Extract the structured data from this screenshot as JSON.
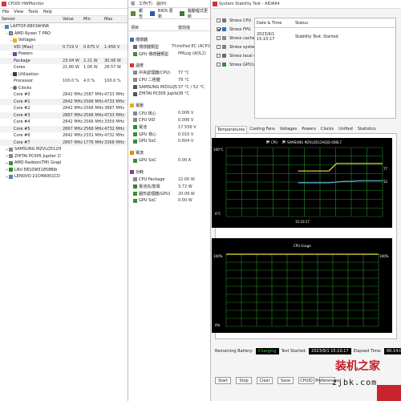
{
  "hwmonitor": {
    "title": "CPUID HWMonitor",
    "menu": [
      "File",
      "View",
      "Tools",
      "Help"
    ],
    "columns": [
      "Sensor",
      "Value",
      "Min",
      "Max"
    ],
    "rows": [
      {
        "label": "LAPTOP-8803AHNR",
        "icon": "computer-icon",
        "indent": 0,
        "toggle": "−",
        "value": "",
        "min": "",
        "max": ""
      },
      {
        "label": "AMD Ryzen 7 PRO",
        "icon": "cpu-icon",
        "indent": 1,
        "toggle": "−",
        "value": "",
        "min": "",
        "max": ""
      },
      {
        "label": "Voltages",
        "icon": "voltage-icon",
        "indent": 2,
        "toggle": "−",
        "value": "",
        "min": "",
        "max": ""
      },
      {
        "label": "VID (Max)",
        "icon": "",
        "indent": 3,
        "toggle": "",
        "value": "0.719 V",
        "min": "0.675 V",
        "max": "1.456 V"
      },
      {
        "label": "Powers",
        "icon": "power-icon",
        "indent": 2,
        "toggle": "−",
        "value": "",
        "min": "",
        "max": ""
      },
      {
        "label": "Package",
        "icon": "",
        "indent": 3,
        "toggle": "",
        "value": "23.04 W",
        "min": "2.21 W",
        "max": "30.06 W"
      },
      {
        "label": "Cores",
        "icon": "",
        "indent": 3,
        "toggle": "",
        "value": "21.80 W",
        "min": "1.06 W",
        "max": "28.57 W"
      },
      {
        "label": "Utilization",
        "icon": "utilization-icon",
        "indent": 2,
        "toggle": "−",
        "value": "",
        "min": "",
        "max": ""
      },
      {
        "label": "Processor",
        "icon": "",
        "indent": 3,
        "toggle": "",
        "value": "100.0 %",
        "min": "4.0 %",
        "max": "100.0 %"
      },
      {
        "label": "Clocks",
        "icon": "clock-icon",
        "indent": 2,
        "toggle": "−",
        "value": "",
        "min": "",
        "max": ""
      },
      {
        "label": "Core #0",
        "icon": "",
        "indent": 3,
        "toggle": "",
        "value": "2842 MHz",
        "min": "2587 MHz",
        "max": "4733 MHz"
      },
      {
        "label": "Core #1",
        "icon": "",
        "indent": 3,
        "toggle": "",
        "value": "2842 MHz",
        "min": "2566 MHz",
        "max": "4733 MHz"
      },
      {
        "label": "Core #2",
        "icon": "",
        "indent": 3,
        "toggle": "",
        "value": "2842 MHz",
        "min": "2566 MHz",
        "max": "3887 MHz"
      },
      {
        "label": "Core #3",
        "icon": "",
        "indent": 3,
        "toggle": "",
        "value": "2867 MHz",
        "min": "2566 MHz",
        "max": "4733 MHz"
      },
      {
        "label": "Core #4",
        "icon": "",
        "indent": 3,
        "toggle": "",
        "value": "2842 MHz",
        "min": "2566 MHz",
        "max": "3359 MHz"
      },
      {
        "label": "Core #5",
        "icon": "",
        "indent": 3,
        "toggle": "",
        "value": "2867 MHz",
        "min": "2566 MHz",
        "max": "4732 MHz"
      },
      {
        "label": "Core #6",
        "icon": "",
        "indent": 3,
        "toggle": "",
        "value": "2842 MHz",
        "min": "2331 MHz",
        "max": "4732 MHz"
      },
      {
        "label": "Core #7",
        "icon": "",
        "indent": 3,
        "toggle": "",
        "value": "2867 MHz",
        "min": "1776 MHz",
        "max": "3368 MHz"
      },
      {
        "label": "SAMSUNG MZVLQ512HCJQ-...",
        "icon": "disk-icon",
        "indent": 1,
        "toggle": "+",
        "value": "",
        "min": "",
        "max": ""
      },
      {
        "label": "ZHITAI PC005 Jupiter 1TB",
        "icon": "disk-icon",
        "indent": 1,
        "toggle": "+",
        "value": "",
        "min": "",
        "max": ""
      },
      {
        "label": "AMD Radeon(TM) Graphics",
        "icon": "gpu-icon",
        "indent": 1,
        "toggle": "+",
        "value": "",
        "min": "",
        "max": ""
      },
      {
        "label": "LNV-5B10W51858Bib",
        "icon": "battery-icon",
        "indent": 1,
        "toggle": "+",
        "value": "",
        "min": "",
        "max": ""
      },
      {
        "label": "LENOVO 21CMA001CD",
        "icon": "computer-icon",
        "indent": 1,
        "toggle": "+",
        "value": "",
        "min": "",
        "max": ""
      }
    ]
  },
  "sensor": {
    "menu": [
      "檔",
      "工作(T)",
      "說(H)"
    ],
    "toolbar": [
      {
        "label": "報告",
        "icon": "report-icon"
      },
      {
        "label": "BIOS 更新",
        "icon": "bios-icon"
      },
      {
        "label": "驅動程式更新",
        "icon": "driver-icon"
      }
    ],
    "columns": [
      "項目",
      "當前值"
    ],
    "groups": [
      {
        "title": "傳感器",
        "icon": "sensor-icon",
        "rows": [
          {
            "label": "傳感器類型",
            "value": "ThinkPad EC (ACPI)",
            "icon": "chip-icon"
          },
          {
            "label": "GPU 傳感器類型",
            "value": "PMLog (ADL2)",
            "icon": "gpu-icon"
          }
        ]
      },
      {
        "title": "溫度",
        "icon": "temperature-icon",
        "rows": [
          {
            "label": "中央處理器(CPU)",
            "value": "77 °C",
            "icon": "cpu-icon"
          },
          {
            "label": "CPU 二極體",
            "value": "78 °C",
            "icon": "cpu-icon"
          },
          {
            "label": "SAMSUNG MZVLQ512HCJQ...",
            "value": "37 °C / 52 °C",
            "icon": "disk-icon"
          },
          {
            "label": "ZHITAI PC005 Jupiter 1TB",
            "value": "38 °C",
            "icon": "disk-icon"
          }
        ]
      },
      {
        "title": "電壓",
        "icon": "voltage-icon",
        "rows": [
          {
            "label": "CPU 核心",
            "value": "0.006 V",
            "icon": "cpu-icon"
          },
          {
            "label": "CPU VID",
            "value": "0.006 V",
            "icon": "cpu-icon"
          },
          {
            "label": "電池",
            "value": "17.556 V",
            "icon": "battery-icon"
          },
          {
            "label": "GPU 核心",
            "value": "0.015 V",
            "icon": "gpu-icon"
          },
          {
            "label": "GPU SoC",
            "value": "0.604 V",
            "icon": "gpu-icon"
          }
        ]
      },
      {
        "title": "電流",
        "icon": "current-icon",
        "rows": [
          {
            "label": "GPU SoC",
            "value": "0.00 A",
            "icon": "gpu-icon"
          }
        ]
      },
      {
        "title": "功耗",
        "icon": "power-icon",
        "rows": [
          {
            "label": "CPU Package",
            "value": "22.00 W",
            "icon": "cpu-icon"
          },
          {
            "label": "電池充/放電",
            "value": "3.72 W",
            "icon": "battery-icon"
          },
          {
            "label": "圖形處理器(GPU)",
            "value": "20.09 W",
            "icon": "gpu-icon"
          },
          {
            "label": "GPU SoC",
            "value": "0.00 W",
            "icon": "gpu-icon"
          }
        ]
      }
    ]
  },
  "stability": {
    "title": "System Stability Test - AIDA64",
    "checks": [
      {
        "label": "Stress CPU",
        "checked": false
      },
      {
        "label": "Stress FPU",
        "checked": true
      },
      {
        "label": "Stress cache",
        "checked": false
      },
      {
        "label": "Stress system memory",
        "checked": false
      },
      {
        "label": "Stress local disks",
        "checked": false
      },
      {
        "label": "Stress GPU(s)",
        "checked": false
      }
    ],
    "log_columns": [
      "Date & Time",
      "Status"
    ],
    "log_rows": [
      {
        "time": "2023/9/1 15:10:17",
        "status": "Stability Test: Started"
      }
    ],
    "tabs": [
      "Temperatures",
      "Cooling Fans",
      "Voltages",
      "Powers",
      "Clocks",
      "Unified",
      "Statistics"
    ],
    "temp_graph": {
      "legend_cpu": "CPU",
      "legend_disk": "SAMSUNG MZVLQ512HCJQ-00BL7",
      "y_top": "100°C",
      "y_bottom": "0°C",
      "value_cpu": "77",
      "value_disk": "52",
      "x_time": "15:10:17"
    },
    "cpu_graph": {
      "title": "CPU Usage",
      "y_top": "100%",
      "y_bottom": "0%",
      "value": "100%"
    },
    "chart_data": [
      {
        "type": "line",
        "title": "",
        "series": [
          {
            "name": "CPU",
            "values": [
              66,
              66,
              66,
              66,
              66,
              77,
              77,
              77,
              77,
              77,
              77,
              77
            ]
          },
          {
            "name": "SAMSUNG MZVLQ512HCJQ-00BL7",
            "values": [
              49,
              49,
              49,
              49,
              49,
              50,
              51,
              51,
              52,
              52,
              52,
              52
            ]
          }
        ],
        "ylim": [
          0,
          100
        ],
        "x_label_at_start_of_rise": "15:10:17",
        "grid": true
      },
      {
        "type": "line",
        "title": "CPU Usage",
        "series": [
          {
            "name": "CPU Usage",
            "values": [
              100,
              100,
              100,
              100,
              100,
              100,
              100,
              100,
              100,
              100,
              100,
              100
            ]
          }
        ],
        "ylim": [
          0,
          100
        ],
        "grid": true
      }
    ],
    "status": {
      "battery_label": "Remaining Battery:",
      "battery_value": "Charging",
      "started_label": "Test Started:",
      "started_value": "2023/9/1 15:10:17",
      "elapsed_label": "Elapsed Time:",
      "elapsed_value": "00:14:09"
    },
    "buttons": [
      "Start",
      "Stop",
      "Clear",
      "Save",
      "CPUID",
      "Preferences"
    ]
  },
  "watermark": {
    "text": "装机之家",
    "url": "zjbk.com"
  },
  "colors": {
    "graph_bg": "#000000",
    "grid": "#2a8a2a",
    "cpu_line": "#e8e83a",
    "disk_line": "#5ab5d8",
    "usage_line": "#e8e83a",
    "status_text": "#3ad03a",
    "watermark": "#c2202a"
  }
}
